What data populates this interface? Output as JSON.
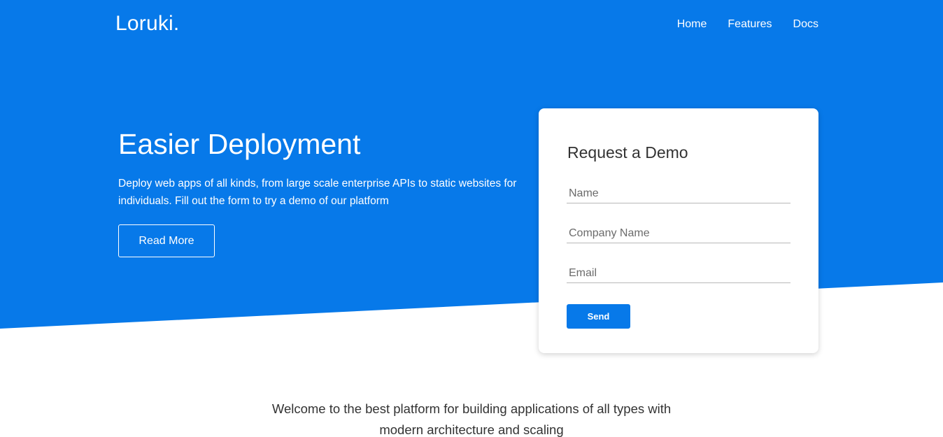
{
  "colors": {
    "brand_blue": "#0779e9",
    "text_dark": "#333333",
    "white": "#ffffff"
  },
  "header": {
    "logo": "Loruki.",
    "nav": [
      "Home",
      "Features",
      "Docs"
    ]
  },
  "hero": {
    "title": "Easier Deployment",
    "description": "Deploy web apps of all kinds, from large scale enterprise APIs to static websites for individuals. Fill out the form to try a demo of our platform",
    "button_label": "Read More"
  },
  "demo_form": {
    "title": "Request a Demo",
    "name_placeholder": "Name",
    "company_placeholder": "Company Name",
    "email_placeholder": "Email",
    "submit_label": "Send"
  },
  "intro": {
    "text": "Welcome to the best platform for building applications of all types with modern architecture and scaling"
  }
}
